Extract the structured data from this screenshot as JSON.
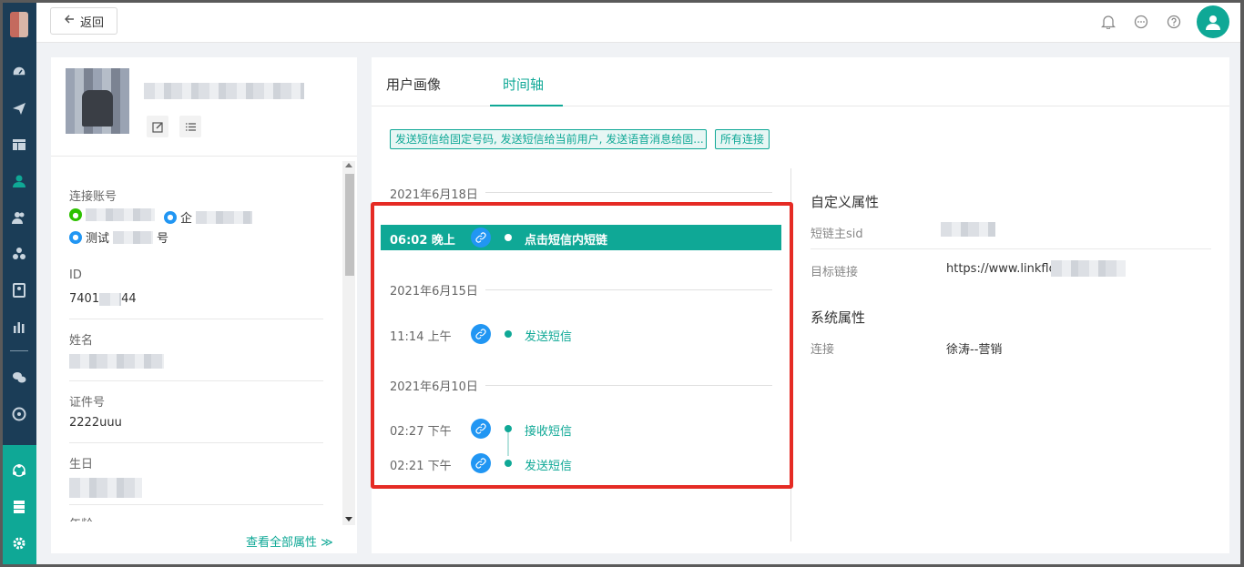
{
  "topbar": {
    "back_label": "返回",
    "icons": [
      "bell-icon",
      "chat-icon",
      "help-icon",
      "user-avatar-icon"
    ]
  },
  "sidebar": {
    "items": [
      "dashboard-icon",
      "send-icon",
      "layout-icon",
      "user-icon",
      "users-icon",
      "cluster-icon",
      "contact-card-icon",
      "bar-chart-icon",
      "wechat-icon",
      "target-icon"
    ],
    "bottom_items": [
      "network-icon",
      "server-icon",
      "gear-icon"
    ]
  },
  "profile": {
    "name_partial": "",
    "edit_icon": "edit-icon",
    "list_icon": "list-icon"
  },
  "fields": {
    "accounts_label": "连接账号",
    "account_1_suffix": "",
    "account_2_prefix": "企",
    "account_3_prefix": "测试",
    "account_3_suffix": "号",
    "id_label": "ID",
    "id_value": "7401",
    "id_value_suffix": "44",
    "name_label": "姓名",
    "certificate_label": "证件号",
    "certificate_value": "2222uuu",
    "birthday_label": "生日",
    "age_label": "年龄",
    "see_all": "查看全部属性 ≫"
  },
  "tabs": {
    "user_portrait": "用户画像",
    "timeline": "时间轴"
  },
  "filters": {
    "event_tag": "发送短信给固定号码, 发送短信给当前用户, 发送语音消息给固...",
    "connection_tag": "所有连接"
  },
  "timeline": {
    "groups": [
      {
        "date": "2021年6月18日",
        "events": [
          {
            "time": "06:02 晚上",
            "name": "点击短信内短链",
            "selected": true
          }
        ]
      },
      {
        "date": "2021年6月15日",
        "events": [
          {
            "time": "11:14 上午",
            "name": "发送短信",
            "selected": false
          }
        ]
      },
      {
        "date": "2021年6月10日",
        "events": [
          {
            "time": "02:27 下午",
            "name": "接收短信",
            "selected": false
          },
          {
            "time": "02:21 下午",
            "name": "发送短信",
            "selected": false
          }
        ]
      }
    ]
  },
  "detail": {
    "custom_title": "自定义属性",
    "short_link_sid_label": "短链主sid",
    "target_link_label": "目标链接",
    "target_link_value": "https://www.linkflo",
    "system_title": "系统属性",
    "connection_label": "连接",
    "connection_value": "徐涛--营销"
  },
  "colors": {
    "brand": "#0fa896",
    "sidebar": "#1b3d57",
    "link_blue": "#2196f3",
    "highlight_red": "#e52b24"
  }
}
